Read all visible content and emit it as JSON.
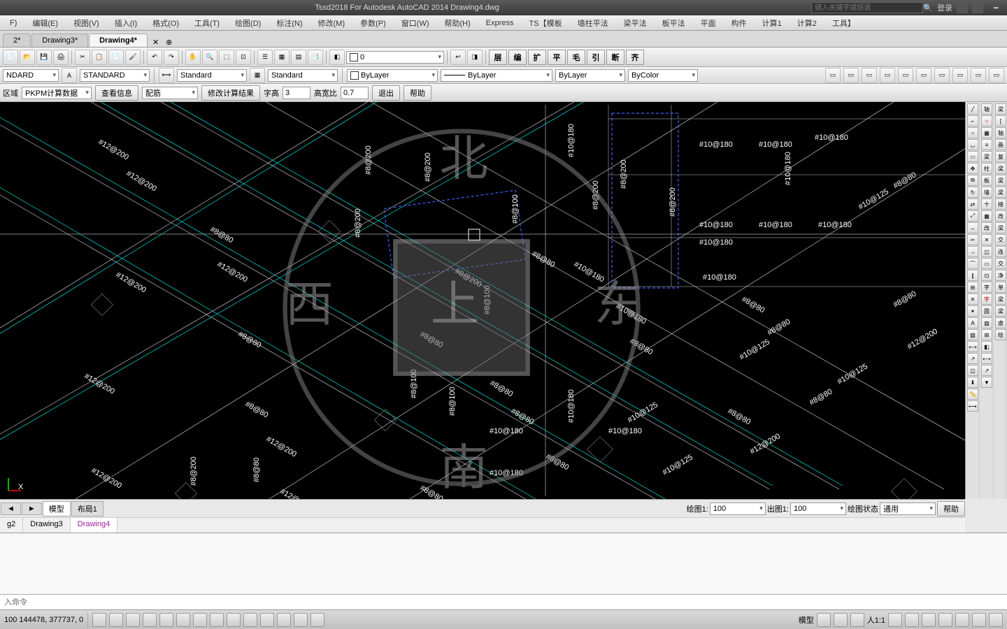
{
  "title": "Tssd2018 For Autodesk AutoCAD 2014    Drawing4.dwg",
  "search_placeholder": "键入关键字或短语",
  "login_label": "登录",
  "menu": [
    "F)",
    "编辑(E)",
    "视图(V)",
    "插入(I)",
    "格式(O)",
    "工具(T)",
    "绘图(D)",
    "标注(N)",
    "修改(M)",
    "参数(P)",
    "窗口(W)",
    "帮助(H)",
    "Express",
    "TS【模板",
    "墙柱平法",
    "梁平法",
    "板平法",
    "平面",
    "构件",
    "计算1",
    "计算2",
    "工具】"
  ],
  "doctabs": [
    {
      "label": "2*",
      "active": false
    },
    {
      "label": "Drawing3*",
      "active": false
    },
    {
      "label": "Drawing4*",
      "active": true
    }
  ],
  "layer_field": "0",
  "style1": "NDARD",
  "style2": "STANDARD",
  "style3": "Standard",
  "style4": "Standard",
  "prop_bylayer1": "ByLayer",
  "prop_bylayer2": "ByLayer",
  "prop_bylayer3": "ByLayer",
  "prop_bycolor": "ByColor",
  "cn_buttons": [
    "层",
    "编",
    "扩",
    "平",
    "毛",
    "引",
    "断",
    "齐"
  ],
  "param": {
    "region": "区域",
    "data_source": "PKPM计算数据",
    "view_info": "查看信息",
    "rebar": "配筋",
    "modify_calc": "修改计算结果",
    "char_height_label": "字高",
    "char_height": "3",
    "aspect_label": "高宽比",
    "aspect": "0.7",
    "exit": "退出",
    "help": "帮助"
  },
  "layout_tabs": [
    {
      "label": "◄",
      "active": false
    },
    {
      "label": "►",
      "active": false
    },
    {
      "label": "模型",
      "active": true
    },
    {
      "label": "布局1",
      "active": false
    }
  ],
  "drawing_tabs": [
    {
      "label": "g2",
      "active": false
    },
    {
      "label": "Drawing3",
      "active": false
    },
    {
      "label": "Drawing4",
      "active": true
    }
  ],
  "scale1_label": "绘图1:",
  "scale1": "100",
  "scale2_label": "出图1:",
  "scale2": "100",
  "drawstate_label": "绘图状态",
  "drawstate": "通用",
  "help_btn": "帮助",
  "cmdline": "入命令",
  "coords": "100   144478, 377737, 0",
  "status_right": {
    "model": "模型",
    "ratio": "人1:1"
  },
  "annotations": [
    "#12@200",
    "#10@180",
    "#8@200",
    "#8@100",
    "#8@80",
    "#10@125",
    "#8@60"
  ]
}
